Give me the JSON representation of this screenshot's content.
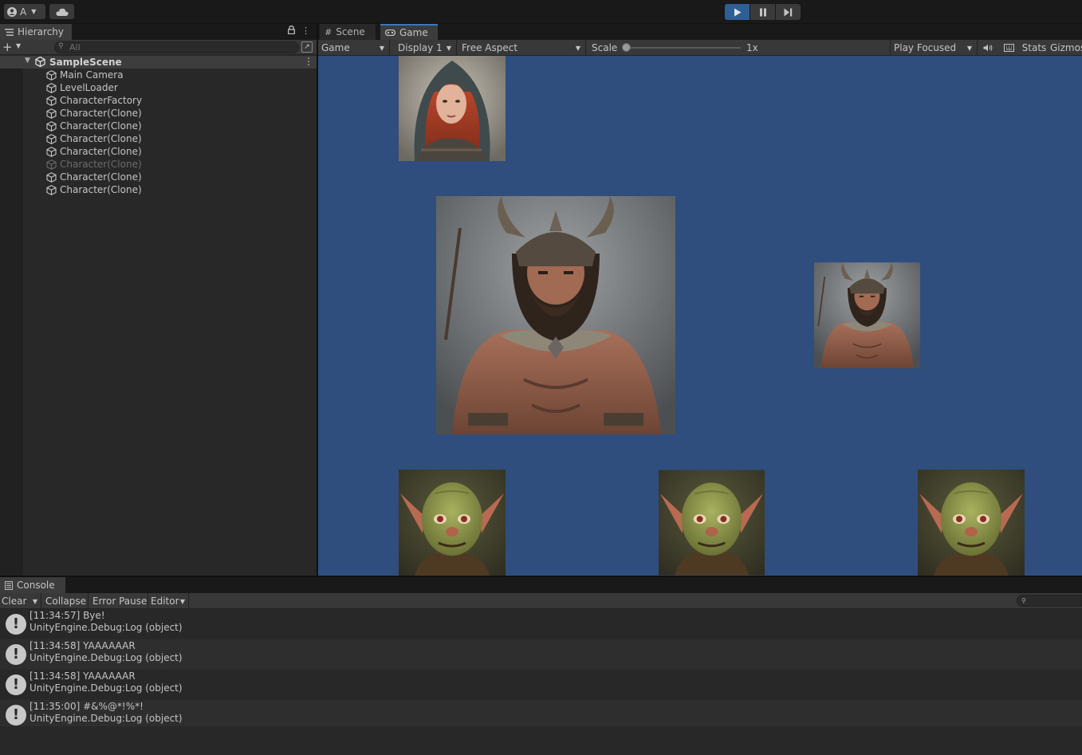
{
  "toolbar": {
    "account_label": "A",
    "account_icon": "account-circle-icon",
    "cloud_icon": "cloud-icon",
    "play_icon": "play-icon",
    "pause_icon": "pause-icon",
    "step_icon": "step-icon",
    "play_active": true,
    "accent_color": "#2d5f96"
  },
  "hierarchy": {
    "tab_label": "Hierarchy",
    "search_placeholder": "All",
    "scene_name": "SampleScene",
    "items": [
      {
        "label": "Main Camera",
        "disabled": false
      },
      {
        "label": "LevelLoader",
        "disabled": false
      },
      {
        "label": "CharacterFactory",
        "disabled": false
      },
      {
        "label": "Character(Clone)",
        "disabled": false
      },
      {
        "label": "Character(Clone)",
        "disabled": false
      },
      {
        "label": "Character(Clone)",
        "disabled": false
      },
      {
        "label": "Character(Clone)",
        "disabled": false
      },
      {
        "label": "Character(Clone)",
        "disabled": true
      },
      {
        "label": "Character(Clone)",
        "disabled": false
      },
      {
        "label": "Character(Clone)",
        "disabled": false
      }
    ]
  },
  "gameview": {
    "tabs": [
      {
        "label": "Scene",
        "icon": "grid-icon"
      },
      {
        "label": "Game",
        "icon": "gamepad-icon"
      }
    ],
    "game_dropdown": "Game",
    "display_dropdown": "Display 1",
    "aspect_dropdown": "Free Aspect",
    "scale_label": "Scale",
    "scale_value": "1x",
    "playmode_dropdown": "Play Focused",
    "stats_label": "Stats",
    "gizmos_label": "Gizmos",
    "background_color": "#2f4e7d",
    "sprites": [
      {
        "name": "red-haired-woman"
      },
      {
        "name": "viking-warrior-large"
      },
      {
        "name": "viking-warrior-small"
      },
      {
        "name": "goblin-1"
      },
      {
        "name": "goblin-2"
      },
      {
        "name": "goblin-3"
      }
    ]
  },
  "console": {
    "tab_label": "Console",
    "clear_label": "Clear",
    "collapse_label": "Collapse",
    "error_pause_label": "Error Pause",
    "editor_label": "Editor",
    "logs": [
      {
        "message": "[11:34:57] Bye!",
        "source": "UnityEngine.Debug:Log (object)"
      },
      {
        "message": "[11:34:58] YAAAAAAR",
        "source": "UnityEngine.Debug:Log (object)"
      },
      {
        "message": "[11:34:58] YAAAAAAR",
        "source": "UnityEngine.Debug:Log (object)"
      },
      {
        "message": "[11:35:00] #&%@*!%*!",
        "source": "UnityEngine.Debug:Log (object)"
      }
    ]
  }
}
